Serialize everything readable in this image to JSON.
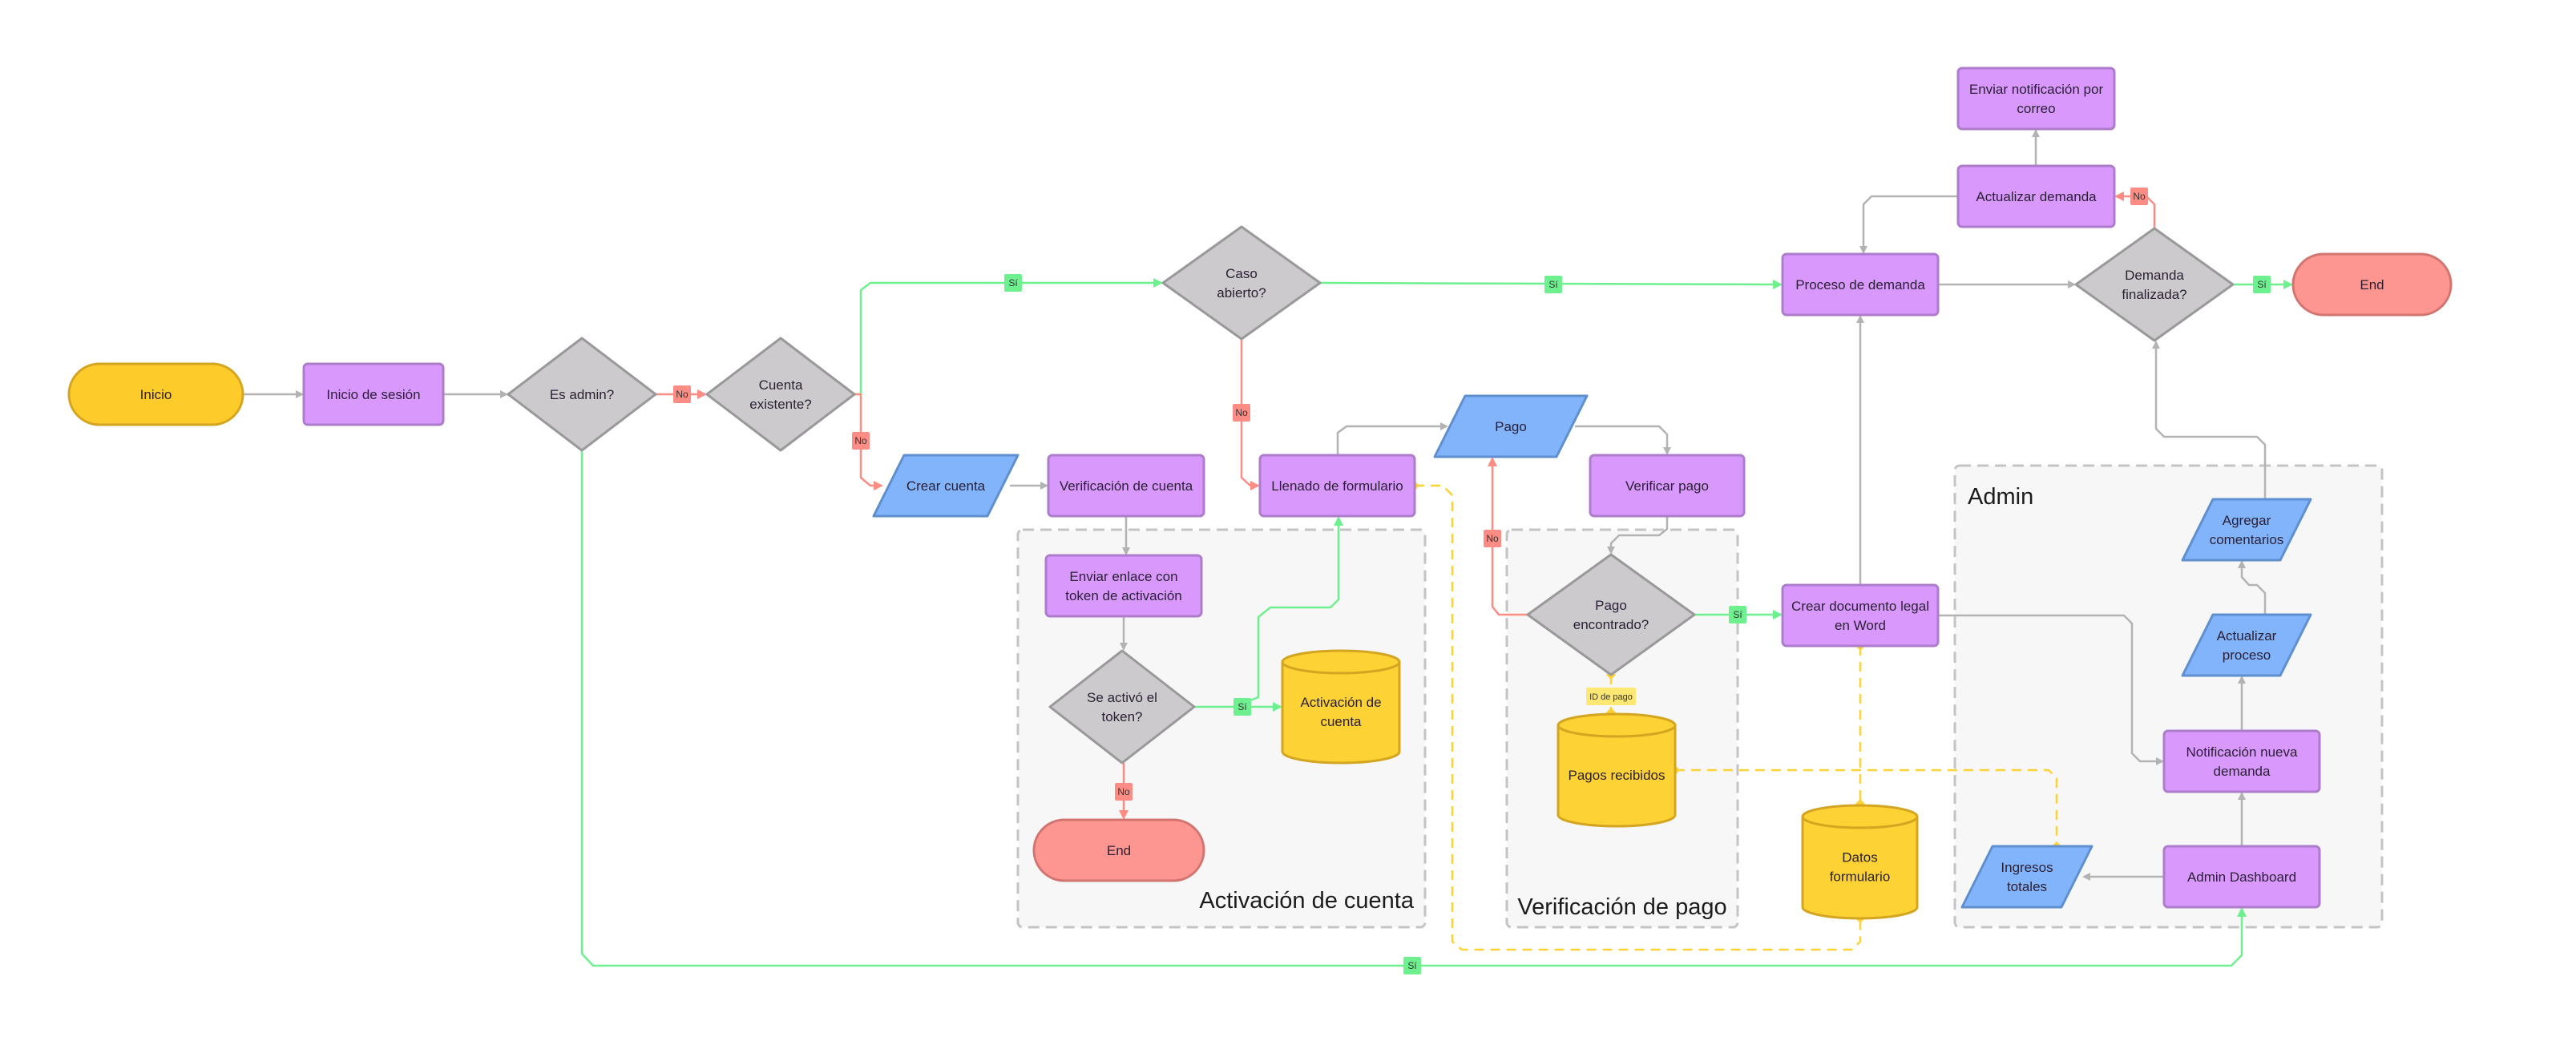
{
  "diagram": {
    "type": "flowchart",
    "colors": {
      "process_fill": "#d898fc",
      "process_stroke": "#ad7ccb",
      "decision_fill": "#cccacc",
      "decision_stroke": "#999999",
      "io_fill": "#82b4fb",
      "io_stroke": "#5f8fcf",
      "terminal_start_fill": "#fdcc2b",
      "terminal_start_stroke": "#d4a520",
      "terminal_end_fill": "#fd9690",
      "terminal_end_stroke": "#d27470",
      "database_fill": "#fdd234",
      "database_stroke": "#d4a520",
      "edge_default": "#b3b3b3",
      "edge_yes": "#6ef08f",
      "edge_no": "#fd8c85",
      "edge_data": "#fdd234",
      "label_yes_bg": "#6ef08f",
      "label_no_bg": "#fd8c85",
      "label_data_bg": "#fde874",
      "group_fill": "#f7f7f7",
      "group_stroke": "#c4c4c4"
    },
    "groups": [
      {
        "id": "activacion",
        "title": "Activación de cuenta"
      },
      {
        "id": "verif_pago",
        "title": "Verificación de pago"
      },
      {
        "id": "admin",
        "title": "Admin"
      }
    ],
    "nodes": [
      {
        "id": "inicio",
        "kind": "terminal-start",
        "lines": [
          "Inicio"
        ]
      },
      {
        "id": "inicio_sesion",
        "kind": "process",
        "lines": [
          "Inicio de sesión"
        ]
      },
      {
        "id": "es_admin",
        "kind": "decision",
        "lines": [
          "Es admin?"
        ]
      },
      {
        "id": "cuenta_existente",
        "kind": "decision",
        "lines": [
          "Cuenta",
          "existente?"
        ]
      },
      {
        "id": "caso_abierto",
        "kind": "decision",
        "lines": [
          "Caso",
          "abierto?"
        ]
      },
      {
        "id": "crear_cuenta",
        "kind": "io",
        "lines": [
          "Crear cuenta"
        ]
      },
      {
        "id": "verificacion_cuenta",
        "kind": "process",
        "lines": [
          "Verificación de cuenta"
        ]
      },
      {
        "id": "enviar_enlace",
        "kind": "process",
        "lines": [
          "Enviar enlace con",
          "token de activación"
        ]
      },
      {
        "id": "se_activo",
        "kind": "decision",
        "lines": [
          "Se activó el",
          "token?"
        ]
      },
      {
        "id": "activacion_db",
        "kind": "database",
        "lines": [
          "Activación de",
          "cuenta"
        ]
      },
      {
        "id": "end_activacion",
        "kind": "terminal-end",
        "lines": [
          "End"
        ]
      },
      {
        "id": "llenado",
        "kind": "process",
        "lines": [
          "Llenado de formulario"
        ]
      },
      {
        "id": "pago",
        "kind": "io",
        "lines": [
          "Pago"
        ]
      },
      {
        "id": "verificar_pago",
        "kind": "process",
        "lines": [
          "Verificar pago"
        ]
      },
      {
        "id": "pago_encontrado",
        "kind": "decision",
        "lines": [
          "Pago",
          "encontrado?"
        ]
      },
      {
        "id": "pagos_recibidos",
        "kind": "database",
        "lines": [
          "Pagos recibidos"
        ]
      },
      {
        "id": "datos_formulario",
        "kind": "database",
        "lines": [
          "Datos",
          "formulario"
        ]
      },
      {
        "id": "crear_documento",
        "kind": "process",
        "lines": [
          "Crear documento legal",
          "en Word"
        ]
      },
      {
        "id": "proceso_demanda",
        "kind": "process",
        "lines": [
          "Proceso de demanda"
        ]
      },
      {
        "id": "actualizar_demanda",
        "kind": "process",
        "lines": [
          "Actualizar demanda"
        ]
      },
      {
        "id": "enviar_notificacion",
        "kind": "process",
        "lines": [
          "Enviar notificación por",
          "correo"
        ]
      },
      {
        "id": "demanda_finalizada",
        "kind": "decision",
        "lines": [
          "Demanda",
          "finalizada?"
        ]
      },
      {
        "id": "end_final",
        "kind": "terminal-end",
        "lines": [
          "End"
        ]
      },
      {
        "id": "agregar_comentarios",
        "kind": "io",
        "lines": [
          "Agregar",
          "comentarios"
        ]
      },
      {
        "id": "actualizar_proceso",
        "kind": "io",
        "lines": [
          "Actualizar",
          "proceso"
        ]
      },
      {
        "id": "notificacion_nueva",
        "kind": "process",
        "lines": [
          "Notificación nueva",
          "demanda"
        ]
      },
      {
        "id": "admin_dashboard",
        "kind": "process",
        "lines": [
          "Admin Dashboard"
        ]
      },
      {
        "id": "ingresos_totales",
        "kind": "io",
        "lines": [
          "Ingresos",
          "totales"
        ]
      }
    ],
    "edges": [
      {
        "id": "e1",
        "from": "inicio",
        "to": "inicio_sesion",
        "kind": "default",
        "label": ""
      },
      {
        "id": "e2",
        "from": "inicio_sesion",
        "to": "es_admin",
        "kind": "default",
        "label": ""
      },
      {
        "id": "e3",
        "from": "es_admin",
        "to": "cuenta_existente",
        "kind": "no",
        "label": "No"
      },
      {
        "id": "e4",
        "from": "cuenta_existente",
        "to": "caso_abierto",
        "kind": "yes",
        "label": "Sí"
      },
      {
        "id": "e5",
        "from": "cuenta_existente",
        "to": "crear_cuenta",
        "kind": "no",
        "label": "No"
      },
      {
        "id": "e6",
        "from": "caso_abierto",
        "to": "proceso_demanda",
        "kind": "yes",
        "label": "Sí"
      },
      {
        "id": "e7",
        "from": "caso_abierto",
        "to": "llenado",
        "kind": "no",
        "label": "No"
      },
      {
        "id": "e8",
        "from": "crear_cuenta",
        "to": "verificacion_cuenta",
        "kind": "default",
        "label": ""
      },
      {
        "id": "e9",
        "from": "verificacion_cuenta",
        "to": "enviar_enlace",
        "kind": "default",
        "label": ""
      },
      {
        "id": "e10",
        "from": "enviar_enlace",
        "to": "se_activo",
        "kind": "default",
        "label": ""
      },
      {
        "id": "e11",
        "from": "se_activo",
        "to": "activacion_db",
        "kind": "yes",
        "label": "Sí"
      },
      {
        "id": "e12",
        "from": "se_activo",
        "to": "llenado",
        "kind": "yes",
        "label": ""
      },
      {
        "id": "e13",
        "from": "se_activo",
        "to": "end_activacion",
        "kind": "no",
        "label": "No"
      },
      {
        "id": "e14",
        "from": "llenado",
        "to": "pago",
        "kind": "default",
        "label": ""
      },
      {
        "id": "e15",
        "from": "pago",
        "to": "verificar_pago",
        "kind": "default",
        "label": ""
      },
      {
        "id": "e16",
        "from": "verificar_pago",
        "to": "pago_encontrado",
        "kind": "default",
        "label": ""
      },
      {
        "id": "e17",
        "from": "pago_encontrado",
        "to": "pago",
        "kind": "no",
        "label": "No"
      },
      {
        "id": "e18",
        "from": "pago_encontrado",
        "to": "crear_documento",
        "kind": "yes",
        "label": "Sí"
      },
      {
        "id": "e19",
        "from": "pago_encontrado",
        "to": "pagos_recibidos",
        "kind": "data",
        "label": "ID de pago"
      },
      {
        "id": "e20",
        "from": "crear_documento",
        "to": "proceso_demanda",
        "kind": "default",
        "label": ""
      },
      {
        "id": "e21",
        "from": "crear_documento",
        "to": "notificacion_nueva",
        "kind": "default",
        "label": ""
      },
      {
        "id": "e22",
        "from": "crear_documento",
        "to": "datos_formulario",
        "kind": "data",
        "label": ""
      },
      {
        "id": "e23",
        "from": "llenado",
        "to": "datos_formulario",
        "kind": "data",
        "label": ""
      },
      {
        "id": "e24",
        "from": "pagos_recibidos",
        "to": "ingresos_totales",
        "kind": "data",
        "label": ""
      },
      {
        "id": "e25",
        "from": "proceso_demanda",
        "to": "demanda_finalizada",
        "kind": "default",
        "label": ""
      },
      {
        "id": "e26",
        "from": "demanda_finalizada",
        "to": "end_final",
        "kind": "yes",
        "label": "Sí"
      },
      {
        "id": "e27",
        "from": "demanda_finalizada",
        "to": "actualizar_demanda",
        "kind": "no",
        "label": "No"
      },
      {
        "id": "e28",
        "from": "actualizar_demanda",
        "to": "enviar_notificacion",
        "kind": "default",
        "label": ""
      },
      {
        "id": "e29",
        "from": "actualizar_demanda",
        "to": "proceso_demanda",
        "kind": "default",
        "label": ""
      },
      {
        "id": "e30",
        "from": "admin_dashboard",
        "to": "notificacion_nueva",
        "kind": "default",
        "label": ""
      },
      {
        "id": "e31",
        "from": "admin_dashboard",
        "to": "ingresos_totales",
        "kind": "default",
        "label": ""
      },
      {
        "id": "e32",
        "from": "notificacion_nueva",
        "to": "actualizar_proceso",
        "kind": "default",
        "label": ""
      },
      {
        "id": "e33",
        "from": "actualizar_proceso",
        "to": "agregar_comentarios",
        "kind": "default",
        "label": ""
      },
      {
        "id": "e34",
        "from": "agregar_comentarios",
        "to": "demanda_finalizada",
        "kind": "default",
        "label": ""
      },
      {
        "id": "e35",
        "from": "es_admin",
        "to": "admin_dashboard",
        "kind": "yes",
        "label": "Sí"
      }
    ]
  }
}
